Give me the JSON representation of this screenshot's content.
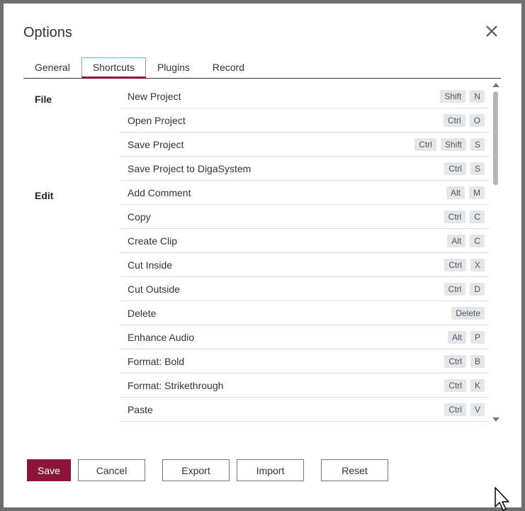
{
  "dialog": {
    "title": "Options"
  },
  "tabs": [
    {
      "label": "General",
      "active": false
    },
    {
      "label": "Shortcuts",
      "active": true
    },
    {
      "label": "Plugins",
      "active": false
    },
    {
      "label": "Record",
      "active": false
    }
  ],
  "sections": [
    {
      "label": "File",
      "rows": [
        {
          "label": "New Project",
          "keys": [
            "Shift",
            "N"
          ]
        },
        {
          "label": "Open Project",
          "keys": [
            "Ctrl",
            "O"
          ]
        },
        {
          "label": "Save Project",
          "keys": [
            "Ctrl",
            "Shift",
            "S"
          ]
        },
        {
          "label": "Save Project to DigaSystem",
          "keys": [
            "Ctrl",
            "S"
          ]
        }
      ]
    },
    {
      "label": "Edit",
      "rows": [
        {
          "label": "Add Comment",
          "keys": [
            "Alt",
            "M"
          ]
        },
        {
          "label": "Copy",
          "keys": [
            "Ctrl",
            "C"
          ]
        },
        {
          "label": "Create Clip",
          "keys": [
            "Alt",
            "C"
          ]
        },
        {
          "label": "Cut Inside",
          "keys": [
            "Ctrl",
            "X"
          ]
        },
        {
          "label": "Cut Outside",
          "keys": [
            "Ctrl",
            "D"
          ]
        },
        {
          "label": "Delete",
          "keys": [
            "Delete"
          ]
        },
        {
          "label": "Enhance Audio",
          "keys": [
            "Alt",
            "P"
          ]
        },
        {
          "label": "Format: Bold",
          "keys": [
            "Ctrl",
            "B"
          ]
        },
        {
          "label": "Format: Strikethrough",
          "keys": [
            "Ctrl",
            "K"
          ]
        },
        {
          "label": "Paste",
          "keys": [
            "Ctrl",
            "V"
          ]
        }
      ]
    }
  ],
  "buttons": {
    "save": "Save",
    "cancel": "Cancel",
    "export": "Export",
    "import": "Import",
    "reset": "Reset"
  },
  "colors": {
    "accent": "#8a1538",
    "tab_border": "#5fb5c8",
    "key_bg": "#e3e6ea"
  }
}
